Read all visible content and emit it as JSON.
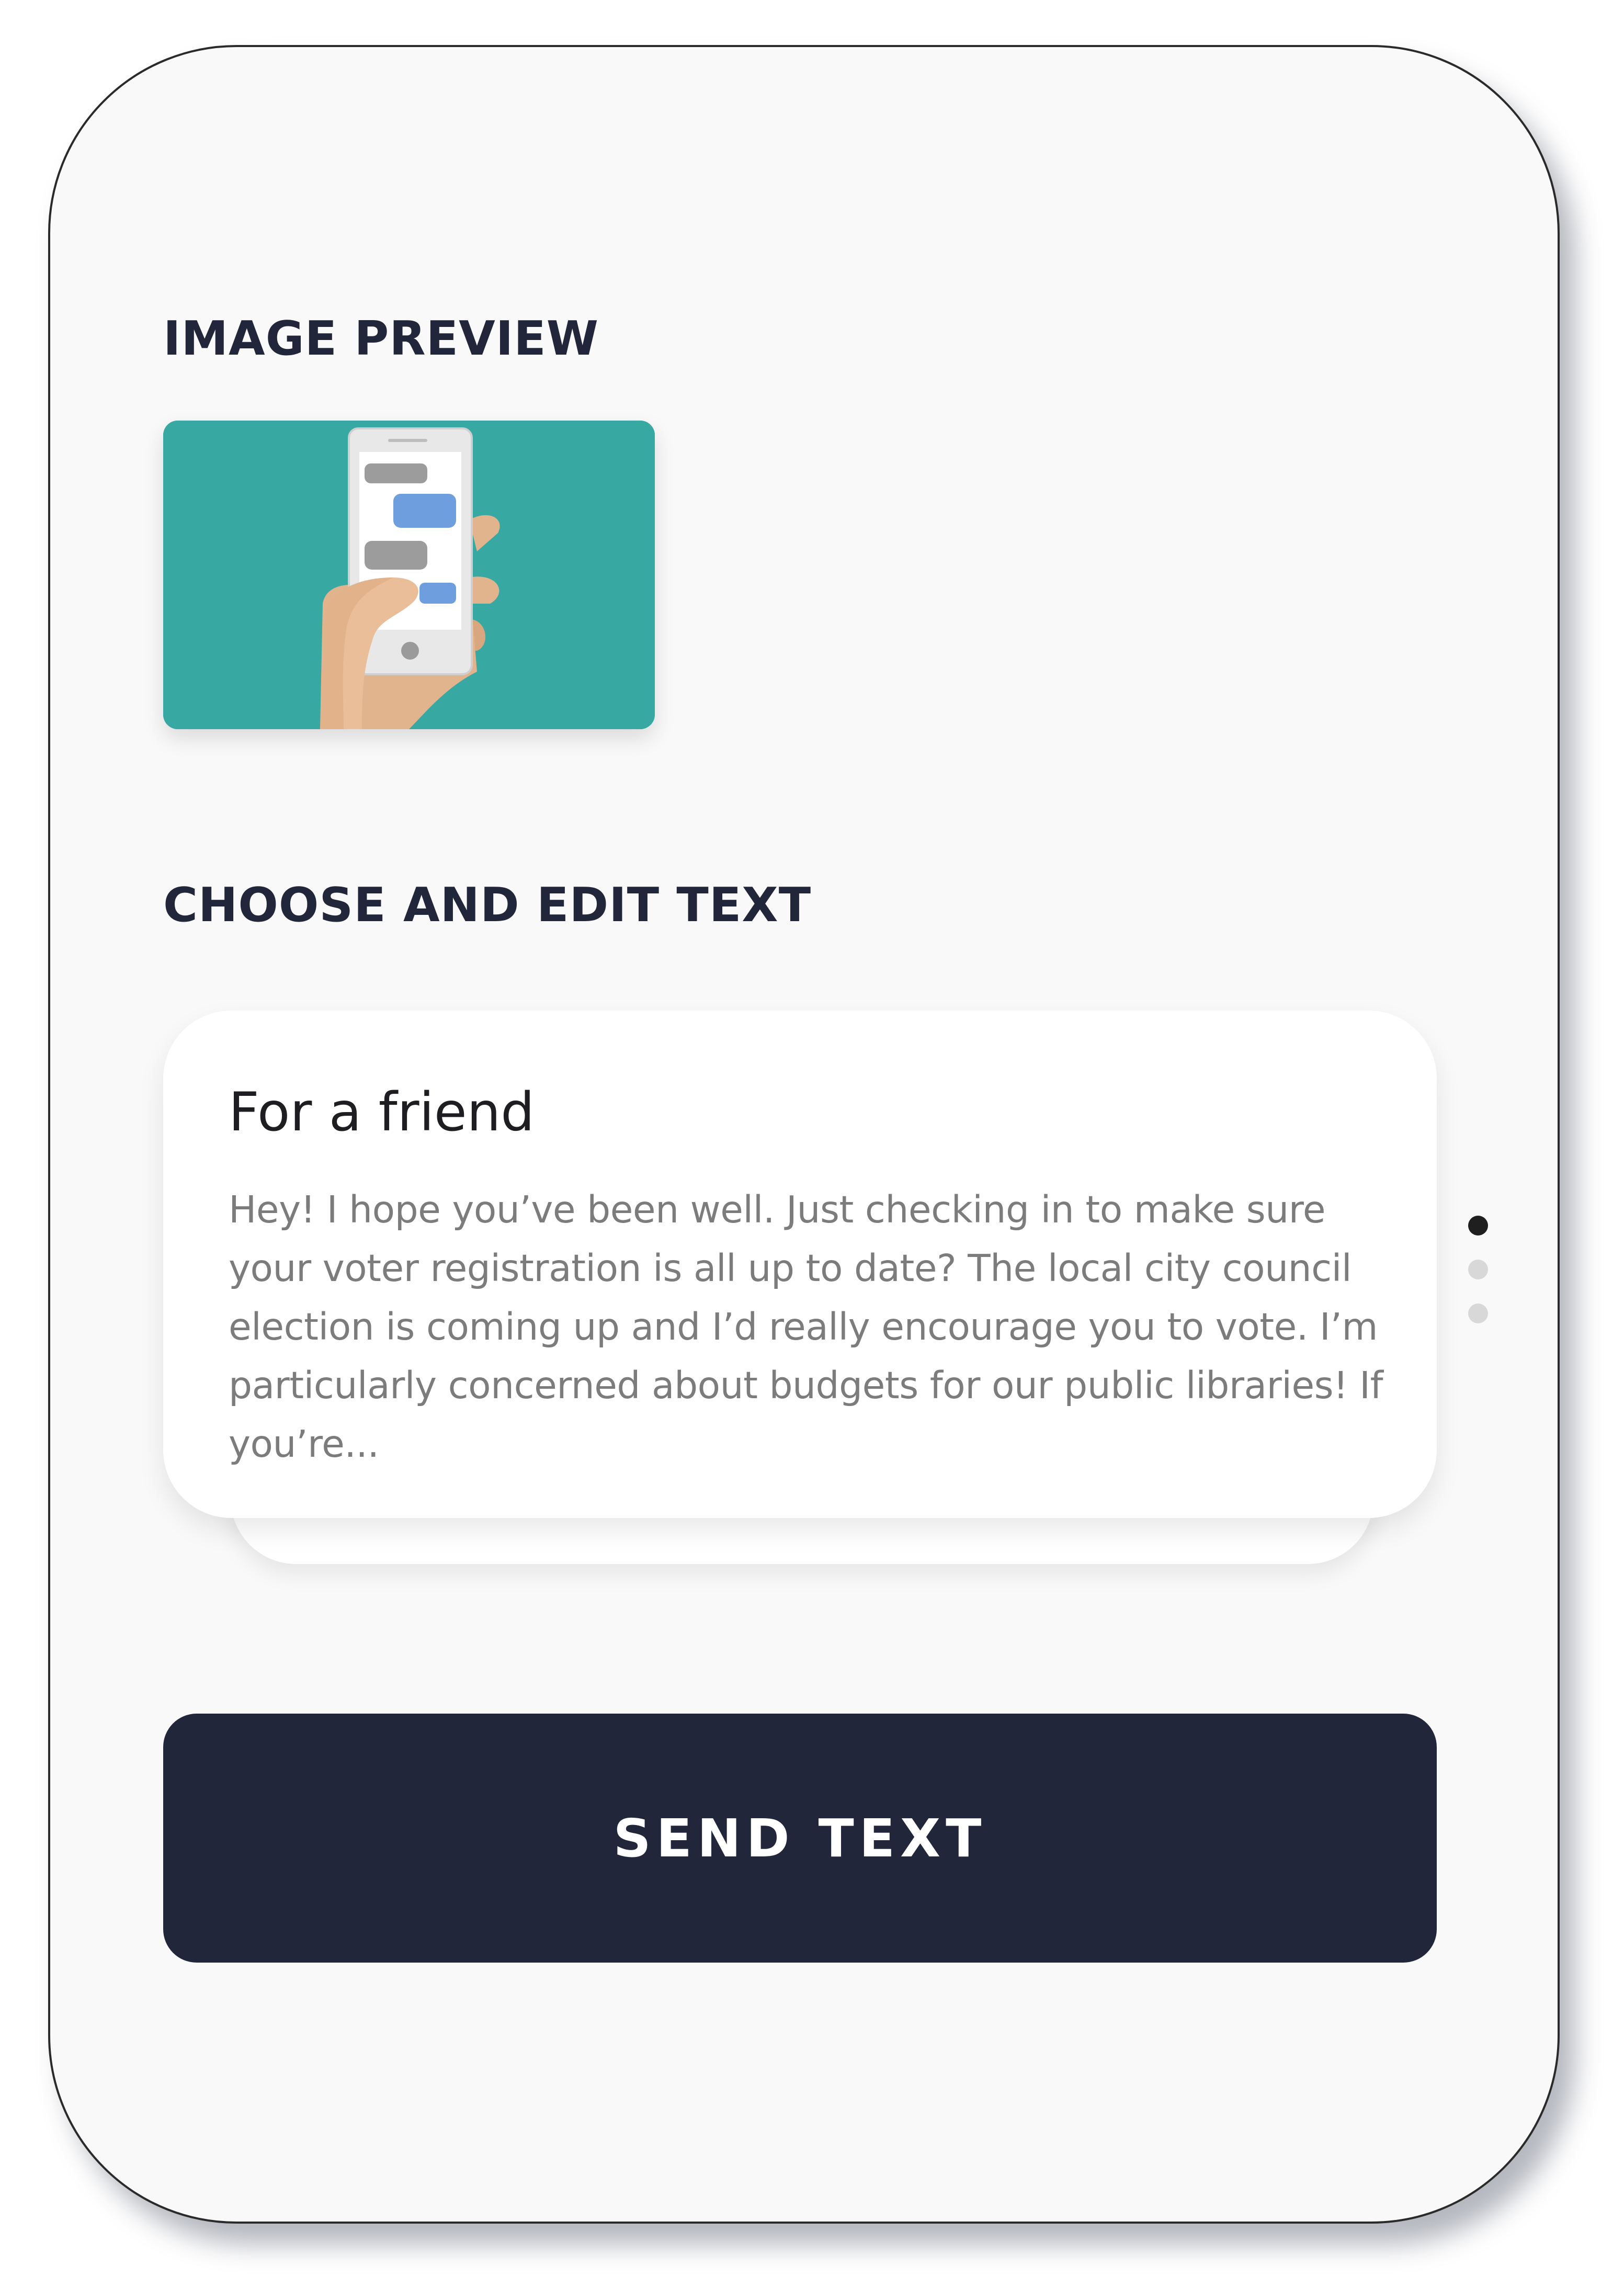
{
  "image_preview": {
    "heading": "IMAGE PREVIEW",
    "illustration": "hand-holding-phone-with-chat-bubbles",
    "background_color": "#37a8a2"
  },
  "choose_text": {
    "heading": "CHOOSE AND EDIT TEXT",
    "card": {
      "title": "For a friend",
      "body": "Hey! I hope you’ve been well. Just checking in to make sure your voter registration is all up to date? The local city council election is coming up and I’d really encourage you to vote. I’m particularly concerned about budgets for our public libraries! If you’re..."
    },
    "pager": {
      "total": 3,
      "active_index": 0
    }
  },
  "send_button": {
    "label": "SEND TEXT",
    "color": "#22263a"
  }
}
